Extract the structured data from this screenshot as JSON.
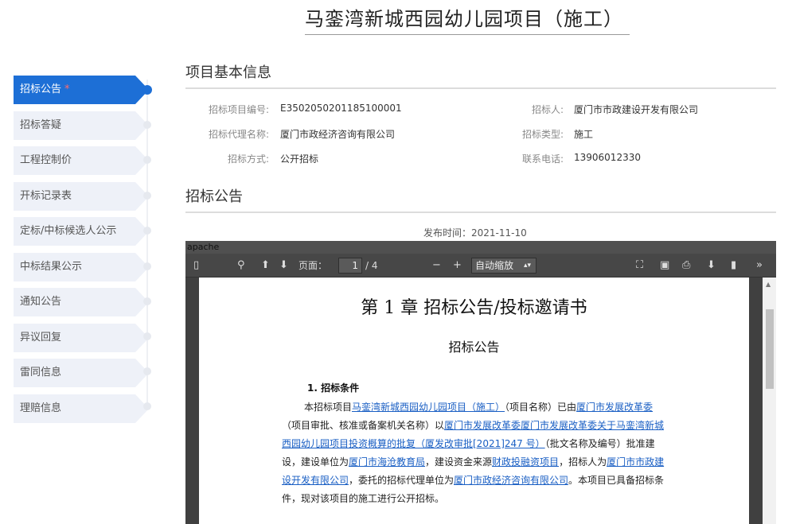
{
  "page_title": "马銮湾新城西园幼儿园项目（施工）",
  "sidebar": {
    "items": [
      {
        "label": "招标公告",
        "active": true,
        "mark": "*"
      },
      {
        "label": "招标答疑"
      },
      {
        "label": "工程控制价"
      },
      {
        "label": "开标记录表"
      },
      {
        "label": "定标/中标候选人公示"
      },
      {
        "label": "中标结果公示"
      },
      {
        "label": "通知公告"
      },
      {
        "label": "异议回复"
      },
      {
        "label": "雷同信息"
      },
      {
        "label": "理赔信息"
      }
    ]
  },
  "basic_info": {
    "section_title": "项目基本信息",
    "project_no_label": "招标项目编号:",
    "project_no": "E3502050201185100001",
    "tenderer_label": "招标人:",
    "tenderer": "厦门市市政建设开发有限公司",
    "agency_label": "招标代理名称:",
    "agency": "厦门市政经济咨询有限公司",
    "type_label": "招标类型:",
    "type": "施工",
    "method_label": "招标方式:",
    "method": "公开招标",
    "phone_label": "联系电话:",
    "phone": "13906012330"
  },
  "notice": {
    "section_title": "招标公告",
    "publish_label": "发布时间：",
    "publish_date": "2021-11-10"
  },
  "pdf_viewer": {
    "header_text": "apache",
    "page_label": "页面：",
    "page_current": "1",
    "page_total": "/ 4",
    "zoom": "自动缩放"
  },
  "document": {
    "chapter": "第 1 章 招标公告/投标邀请书",
    "heading": "招标公告",
    "item_heading": "1. 招标条件",
    "p1": "本招标项目",
    "link1": "马銮湾新城西园幼儿园项目（施工）",
    "p2": "（项目名称）已由",
    "link2": "厦门市发展改革委",
    "p3": "（项目审批、核准或备案机关名称）以",
    "link3": "厦门市发展改革委厦门市发展改革委关于马銮湾新城西园幼儿园项目投资概算的批复（厦发改审批[2021]247 号）",
    "p4": "（批文名称及编号）批准建设，建设单位为",
    "link4": "厦门市海沧教育局",
    "p5": "，建设资金来源",
    "link5": "财政投融资项目",
    "p6": "，招标人为",
    "link6": "厦门市市政建设开发有限公司",
    "p7": "，委托的招标代理单位为",
    "link7": "厦门市政经济咨询有限公司",
    "p8": "。本项目已具备招标条件，现对该项目的施工进行公开招标。"
  }
}
